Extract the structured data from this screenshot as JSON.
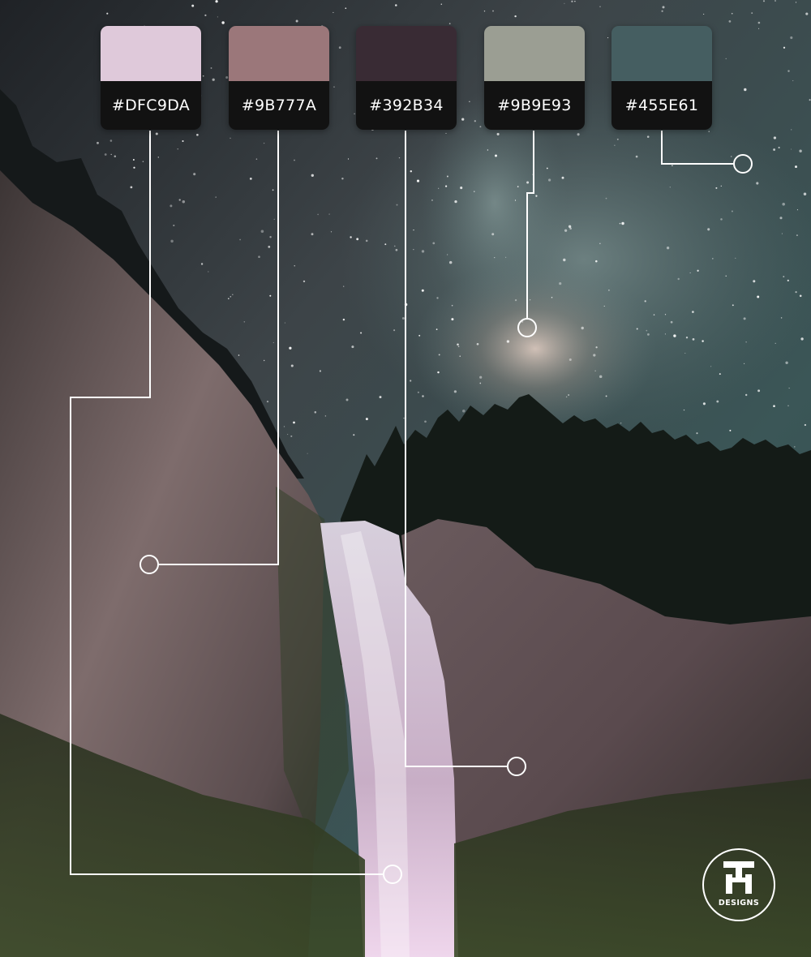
{
  "palette": {
    "swatches": [
      {
        "name": "swatch-1",
        "hex": "#DFC9DA",
        "label": "#DFC9DA"
      },
      {
        "name": "swatch-2",
        "hex": "#9B777A",
        "label": "#9B777A"
      },
      {
        "name": "swatch-3",
        "hex": "#392B34",
        "label": "#392B34"
      },
      {
        "name": "swatch-4",
        "hex": "#9B9E93",
        "label": "#9B9E93"
      },
      {
        "name": "swatch-5",
        "hex": "#455E61",
        "label": "#455E61"
      }
    ]
  },
  "photo": {
    "subject_icons": [
      "night-sky",
      "milky-way",
      "cliff",
      "waterfall",
      "forest"
    ]
  },
  "logo": {
    "icon": "brand-logo-icon",
    "word": "DESIGNS"
  },
  "colors": {
    "code_bar": "#121212",
    "leader_line": "#FFFFFF"
  }
}
